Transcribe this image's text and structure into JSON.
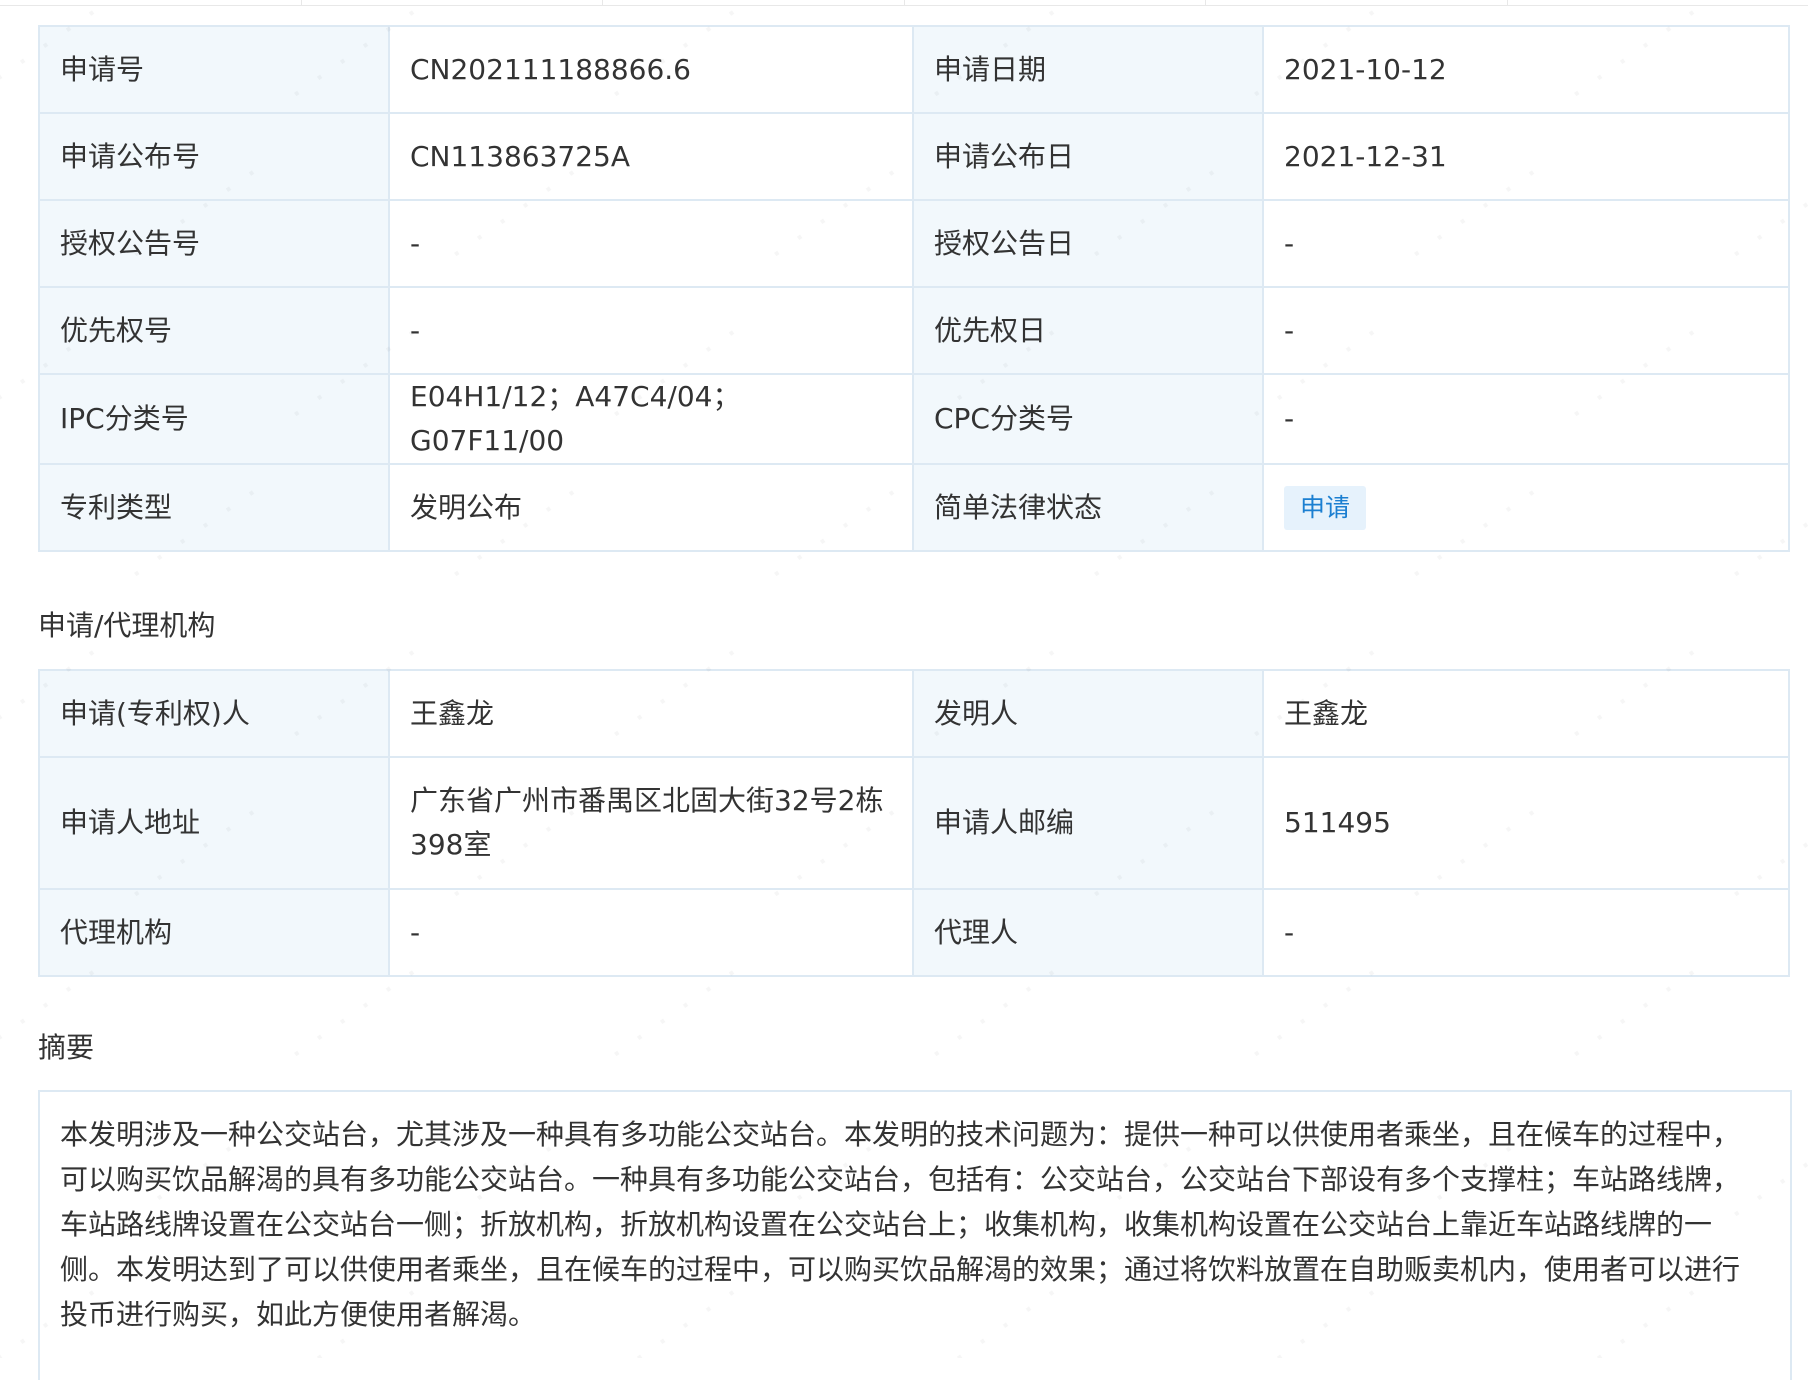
{
  "basic_info": {
    "rows": [
      {
        "k1": "申请号",
        "v1": "CN202111188866.6",
        "k2": "申请日期",
        "v2": "2021-10-12"
      },
      {
        "k1": "申请公布号",
        "v1": "CN113863725A",
        "k2": "申请公布日",
        "v2": "2021-12-31"
      },
      {
        "k1": "授权公告号",
        "v1": "-",
        "k2": "授权公告日",
        "v2": "-"
      },
      {
        "k1": "优先权号",
        "v1": "-",
        "k2": "优先权日",
        "v2": "-"
      },
      {
        "k1": "IPC分类号",
        "v1": "E04H1/12；A47C4/04；G07F11/00",
        "k2": "CPC分类号",
        "v2": "-"
      },
      {
        "k1": "专利类型",
        "v1": "发明公布",
        "k2": "简单法律状态",
        "v2": "申请"
      }
    ],
    "status_badge_color": "#1b7fd1"
  },
  "agency_section": {
    "title": "申请/代理机构",
    "rows": [
      {
        "k1": "申请(专利权)人",
        "v1": "王鑫龙",
        "k2": "发明人",
        "v2": "王鑫龙"
      },
      {
        "k1": "申请人地址",
        "v1a": "广东省广州市番禺区北固大街32号2栋",
        "v1b": "398室",
        "k2": "申请人邮编",
        "v2": "511495"
      },
      {
        "k1": "代理机构",
        "v1": "-",
        "k2": "代理人",
        "v2": "-"
      }
    ]
  },
  "abstract_section": {
    "title": "摘要",
    "lines": [
      "本发明涉及一种公交站台，尤其涉及一种具有多功能公交站台。本发明的技术问题为：提供一种可以供使用者乘坐，且在候车的过程中，",
      "可以购买饮品解渴的具有多功能公交站台。一种具有多功能公交站台，包括有：公交站台，公交站台下部设有多个支撑柱；车站路线牌，",
      "车站路线牌设置在公交站台一侧；折放机构，折放机构设置在公交站台上；收集机构，收集机构设置在公交站台上靠近车站路线牌的一",
      "侧。本发明达到了可以供使用者乘坐，且在候车的过程中，可以购买饮品解渴的效果；通过将饮料放置在自助贩卖机内，使用者可以进行",
      "投币进行购买，如此方便使用者解渴。"
    ]
  }
}
